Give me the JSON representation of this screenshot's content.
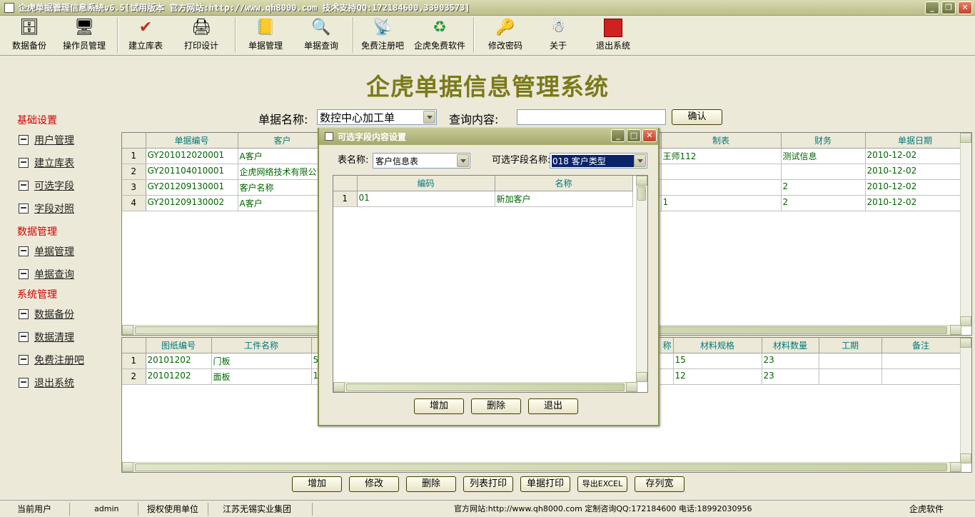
{
  "window": {
    "title": "企虎单据管理信息系统v6.5[试用版本 官方网站:http://www.qh8000.com 技术支持QQ:172184600,33903573]"
  },
  "toolbar": [
    {
      "label": "数据备份",
      "icon": "database-icon",
      "glyph": "🗄"
    },
    {
      "label": "操作员管理",
      "icon": "operator-icon",
      "glyph": "🖥"
    },
    {
      "label": "建立库表",
      "icon": "create-table-icon",
      "glyph": "✔"
    },
    {
      "label": "打印设计",
      "icon": "printer-icon",
      "glyph": "🖨"
    },
    {
      "label": "单据管理",
      "icon": "document-manage-icon",
      "glyph": "📒"
    },
    {
      "label": "单据查询",
      "icon": "search-icon",
      "glyph": "🔍"
    },
    {
      "label": "免费注册吧",
      "icon": "register-icon",
      "glyph": "📡"
    },
    {
      "label": "企虎免费软件",
      "icon": "refresh-icon",
      "glyph": "♻"
    },
    {
      "label": "修改密码",
      "icon": "key-icon",
      "glyph": "🔑"
    },
    {
      "label": "关于",
      "icon": "about-icon",
      "glyph": "☃"
    },
    {
      "label": "退出系统",
      "icon": "exit-icon",
      "glyph": "⬛"
    }
  ],
  "banner": {
    "title": "企虎单据信息管理系统"
  },
  "nav": {
    "groups": [
      {
        "title": "基础设置",
        "items": [
          "用户管理",
          "建立库表",
          "可选字段",
          "字段对照"
        ]
      },
      {
        "title": "数据管理",
        "items": [
          "单据管理",
          "单据查询"
        ]
      },
      {
        "title": "系统管理",
        "items": [
          "数据备份",
          "数据清理",
          "免费注册吧",
          "退出系统"
        ]
      }
    ]
  },
  "query": {
    "name_label": "单据名称:",
    "name_value": "数控中心加工单",
    "content_label": "查询内容:",
    "content_value": "",
    "confirm_label": "确认"
  },
  "top_grid": {
    "columns": [
      "单据编号",
      "客户",
      "制表",
      "财务",
      "单据日期"
    ],
    "rows": [
      {
        "num": "1",
        "code": "GY201012020001",
        "customer": "A客户",
        "maker": "王师112",
        "finance": "测试信息",
        "date": "2010-12-02"
      },
      {
        "num": "2",
        "code": "GY201104010001",
        "customer": "企虎网络技术有限公司",
        "maker": "",
        "finance": "",
        "date": "2010-12-02"
      },
      {
        "num": "3",
        "code": "GY201209130001",
        "customer": "客户名称",
        "maker": "",
        "finance": "2",
        "date": "2010-12-02"
      },
      {
        "num": "4",
        "code": "GY201209130002",
        "customer": "A客户",
        "maker": "1",
        "finance": "2",
        "date": "2010-12-02"
      }
    ]
  },
  "bottom_grid": {
    "columns": [
      "图纸编号",
      "工件名称",
      "称",
      "材料规格",
      "材料数量",
      "工期",
      "备注"
    ],
    "rows": [
      {
        "num": "1",
        "drawing": "20101202",
        "part": "门板",
        "qty_hint": "5",
        "spec": "15",
        "amount": "23",
        "period": "",
        "note": ""
      },
      {
        "num": "2",
        "drawing": "20101202",
        "part": "面板",
        "qty_hint": "1",
        "spec": "12",
        "amount": "23",
        "period": "",
        "note": ""
      }
    ]
  },
  "bottom_buttons": [
    "增加",
    "修改",
    "删除",
    "列表打印",
    "单据打印",
    "导出EXCEL",
    "存列宽"
  ],
  "status": {
    "user_label": "当前用户",
    "user_value": "admin",
    "unit_label": "授权使用单位",
    "unit_value": "江苏无锡实业集团",
    "contact": "官方网站:http://www.qh8000.com 定制咨询QQ:172184600 电话:18992030956",
    "brand": "企虎软件"
  },
  "modal": {
    "title": "可选字段内容设置",
    "table_label": "表名称:",
    "table_value": "客户信息表",
    "field_label": "可选字段名称:",
    "field_value": "018 客户类型",
    "columns": [
      "编码",
      "名称"
    ],
    "rows": [
      {
        "num": "1",
        "code": "01",
        "name": "新加客户"
      }
    ],
    "buttons": [
      "增加",
      "删除",
      "退出"
    ]
  },
  "colors": {
    "accent_title": "#7a7a1a",
    "nav_group": "#d00000",
    "grid_text": "#006600",
    "grid_header": "#007a7a"
  }
}
